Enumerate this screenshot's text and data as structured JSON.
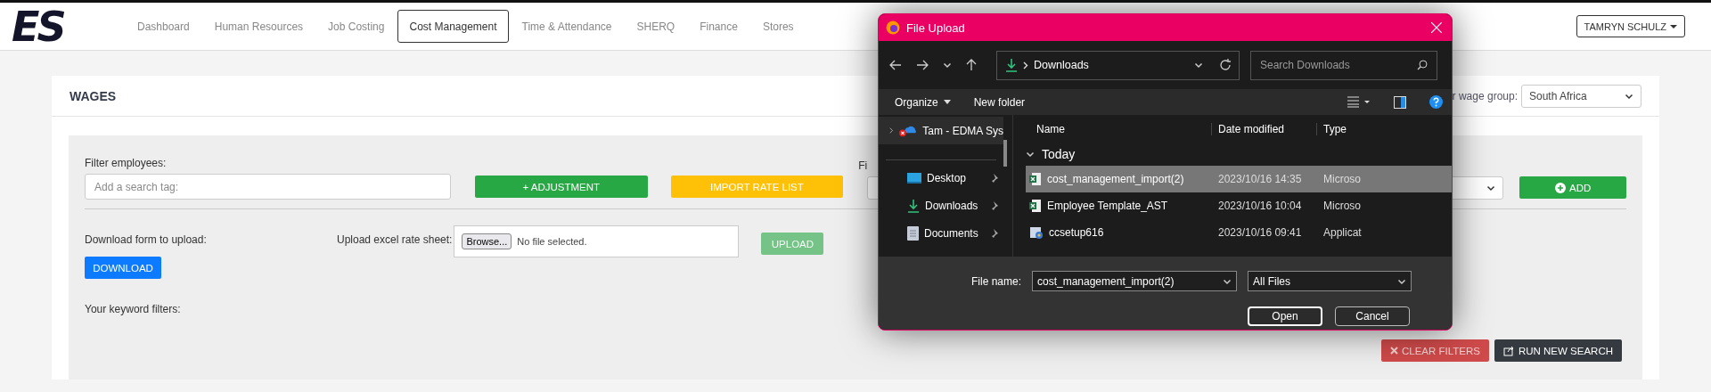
{
  "logo": {
    "text": "ES"
  },
  "nav": {
    "items": [
      {
        "label": "Dashboard",
        "selected": false
      },
      {
        "label": "Human Resources",
        "selected": false
      },
      {
        "label": "Job Costing",
        "selected": false
      },
      {
        "label": "Cost Management",
        "selected": true
      },
      {
        "label": "Time & Attendance",
        "selected": false
      },
      {
        "label": "SHERQ",
        "selected": false
      },
      {
        "label": "Finance",
        "selected": false
      },
      {
        "label": "Stores",
        "selected": false
      }
    ]
  },
  "user_menu": {
    "label": "TAMRYN SCHULZ"
  },
  "card": {
    "title": "WAGES",
    "wage_group": {
      "label": "r wage group:",
      "value": "South Africa"
    }
  },
  "filters": {
    "label": "Filter employees:",
    "search_placeholder": "Add a search tag:",
    "buttons": [
      {
        "label": "+ ADJUSTMENT",
        "kind": "success"
      },
      {
        "label": "IMPORT RATE LIST",
        "kind": "warning"
      }
    ],
    "cut_label": "Fi",
    "add_button": "ADD"
  },
  "upload": {
    "download_label": "Download form to upload:",
    "download_button": "DOWNLOAD",
    "upload_label": "Upload excel rate sheet:",
    "browse_button": "Browse...",
    "file_status": "No file selected.",
    "upload_button": "UPLOAD",
    "upload_disabled": true
  },
  "keywords": {
    "label": "Your keyword filters:",
    "clear_button": "CLEAR FILTERS",
    "search_button": "RUN NEW SEARCH"
  },
  "dialog": {
    "title": "File Upload",
    "path": "Downloads",
    "search_placeholder": "Search Downloads",
    "organize": "Organize",
    "new_folder": "New folder",
    "nav_items": [
      {
        "label": "Tam - EDMA Sys",
        "kind": "cloud",
        "selected": true
      },
      {
        "label": "Desktop",
        "kind": "desktop",
        "selected": false
      },
      {
        "label": "Downloads",
        "kind": "download",
        "selected": false
      },
      {
        "label": "Documents",
        "kind": "document",
        "selected": false
      }
    ],
    "columns": [
      "Name",
      "Date modified",
      "Type"
    ],
    "group": "Today",
    "files": [
      {
        "name": "cost_management_import(2)",
        "date": "2023/10/16 14:35",
        "type": "Microso",
        "kind": "excel",
        "selected": true
      },
      {
        "name": "Employee Template_AST",
        "date": "2023/10/16 10:04",
        "type": "Microso",
        "kind": "excel",
        "selected": false
      },
      {
        "name": "ccsetup616",
        "date": "2023/10/16 09:41",
        "type": "Applicat",
        "kind": "installer",
        "selected": false
      }
    ],
    "file_name_label": "File name:",
    "file_name": "cost_management_import(2)",
    "file_filter": "All Files",
    "buttons": [
      "Open",
      "Cancel"
    ]
  }
}
